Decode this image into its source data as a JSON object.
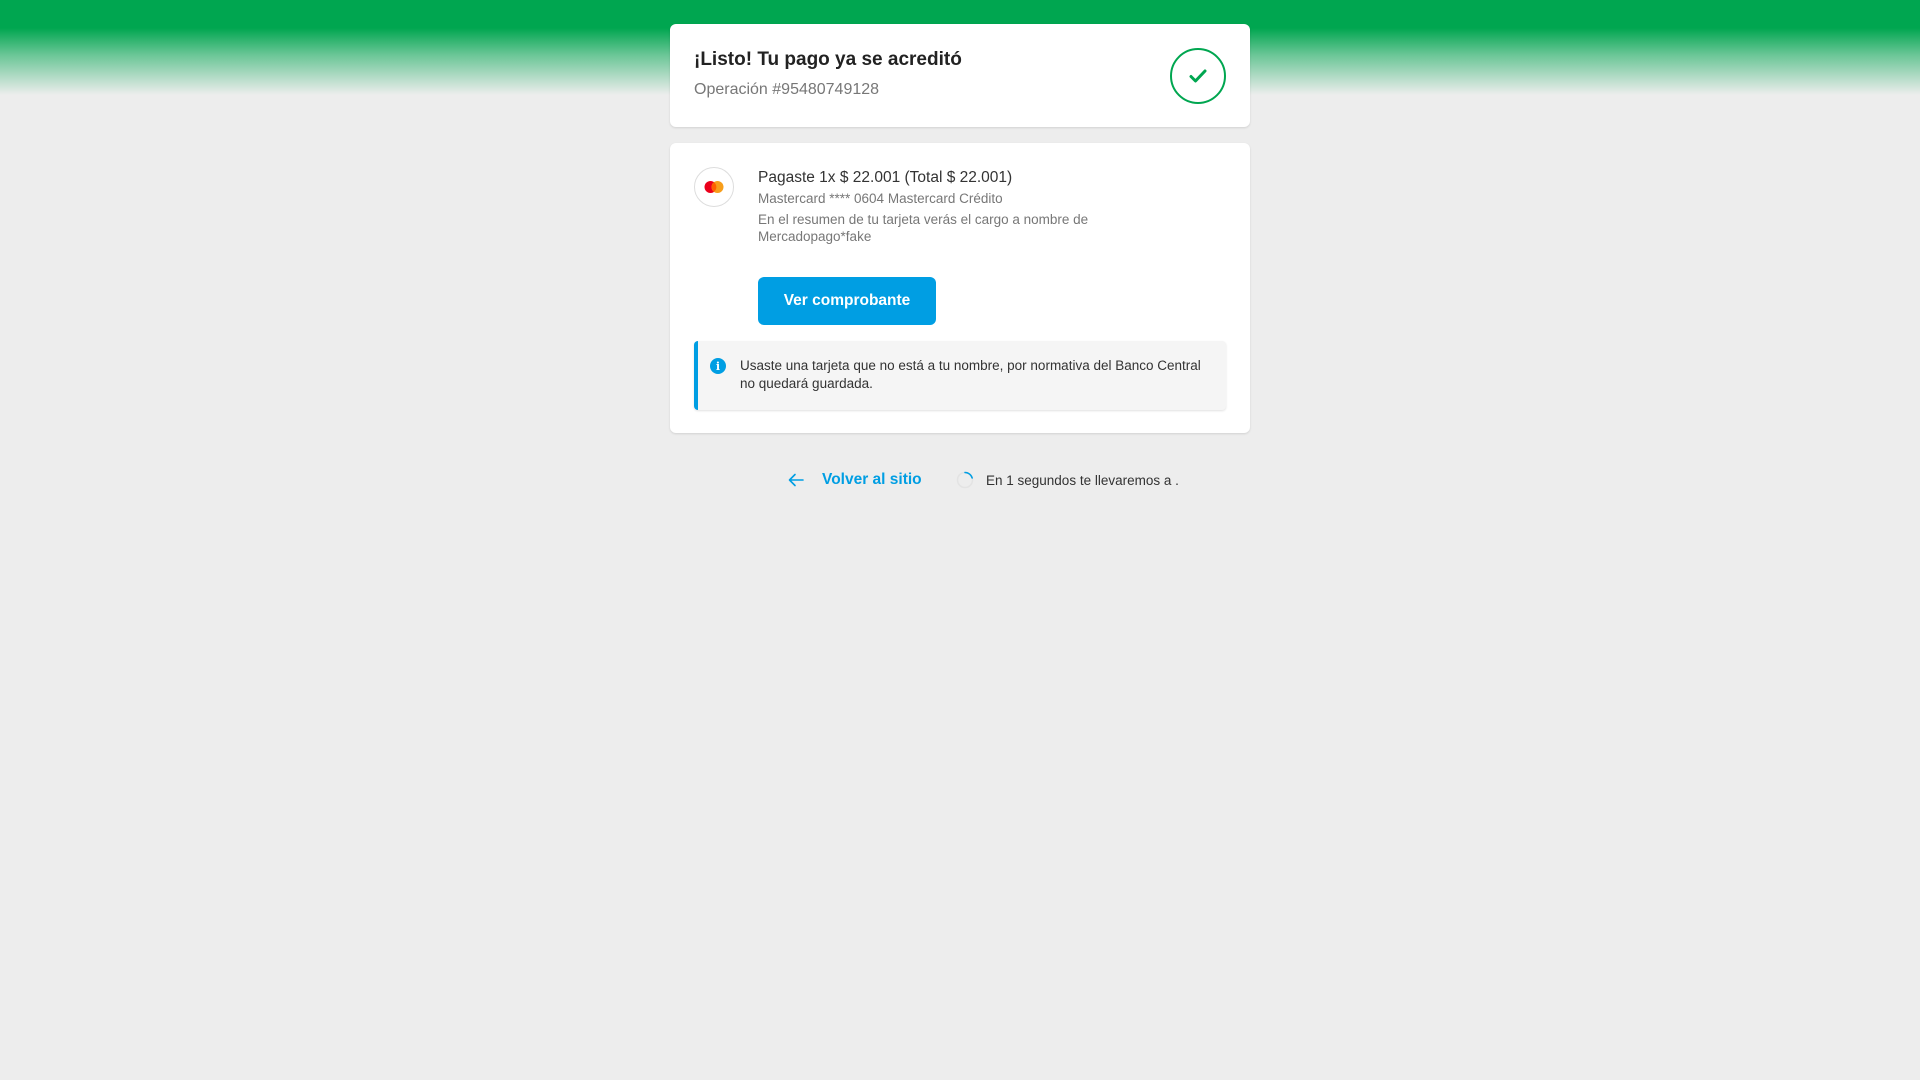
{
  "header": {
    "title": "¡Listo! Tu pago ya se acreditó",
    "operation": "Operación #95480749128"
  },
  "payment": {
    "summary": "Pagaste 1x $ 22.001 (Total $ 22.001)",
    "card": "Mastercard **** 0604 Mastercard Crédito",
    "statement_note": "En el resumen de tu tarjeta verás el cargo a nombre de Mercadopago*fake",
    "card_brand_icon": "mastercard-icon",
    "button_label": "Ver comprobante"
  },
  "notice": {
    "icon": "info-icon",
    "text": "Usaste una tarjeta que no está a tu nombre, por normativa del Banco Central no quedará guardada."
  },
  "footer": {
    "back_label": "Volver al sitio",
    "redirect_text": "En 1 segundos te llevaremos a ."
  },
  "colors": {
    "success_green": "#00a650",
    "accent_blue": "#009ee3",
    "background": "#ededed"
  }
}
